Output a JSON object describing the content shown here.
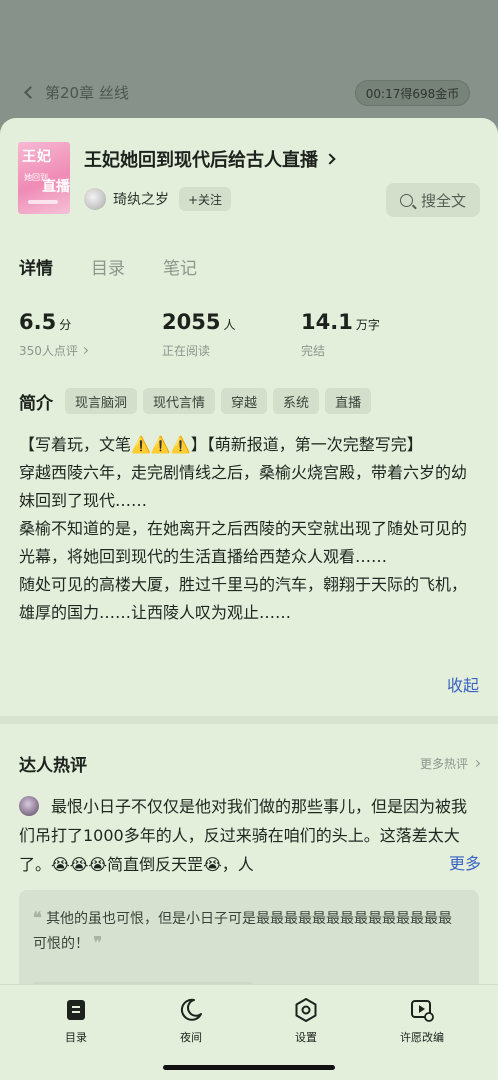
{
  "reader": {
    "chapter_title": "第20章 丝线",
    "timer_text": "00:17得698金币"
  },
  "book": {
    "cover_text": "王妃 她回到 直播",
    "title": "王妃她回到现代后给古人直播",
    "author": "琦纨之岁",
    "follow_label": "+关注",
    "search_label": "搜全文"
  },
  "tabs": [
    {
      "label": "详情",
      "active": true
    },
    {
      "label": "目录",
      "active": false
    },
    {
      "label": "笔记",
      "active": false
    }
  ],
  "stats": {
    "score": {
      "value": "6.5",
      "unit": "分",
      "sub": "350人点评"
    },
    "reading": {
      "value": "2055",
      "unit": "人",
      "sub": "正在阅读"
    },
    "words": {
      "value": "14.1",
      "unit": "万字",
      "sub": "完结"
    }
  },
  "intro": {
    "label": "简介",
    "tags": [
      "现言脑洞",
      "现代言情",
      "穿越",
      "系统",
      "直播"
    ],
    "paragraphs": [
      "【写着玩，文笔⚠️⚠️⚠️】【萌新报道，第一次完整写完】",
      "穿越西陵六年，走完剧情线之后，桑榆火烧宫殿，带着六岁的幼妹回到了现代……",
      "桑榆不知道的是，在她离开之后西陵的天空就出现了随处可见的光幕，将她回到现代的生活直播给西楚众人观看……",
      "随处可见的高楼大厦，胜过千里马的汽车，翱翔于天际的飞机，雄厚的国力……让西陵人叹为观止……"
    ],
    "collapse_label": "收起"
  },
  "reviews": {
    "title": "达人热评",
    "more_label": "更多热评",
    "top_review": {
      "text": "最恨小日子不仅仅是他对我们做的那些事儿，但是因为被我们吊打了1000多年的人，反过来骑在咱们的头上。这落差太大了。😭😭😭简直倒反天罡😭，人",
      "more_label": "更多"
    },
    "quote": {
      "open_mark": "❝",
      "text": "其他的虽也可恨，但是小日子可是最最最最最最最最最最最最最最可恨的！",
      "close_mark": "❞"
    }
  },
  "bottom_nav": [
    {
      "label": "目录",
      "icon": "catalog-icon"
    },
    {
      "label": "夜间",
      "icon": "moon-icon"
    },
    {
      "label": "设置",
      "icon": "settings-icon"
    },
    {
      "label": "许愿改编",
      "icon": "wish-video-icon"
    }
  ]
}
